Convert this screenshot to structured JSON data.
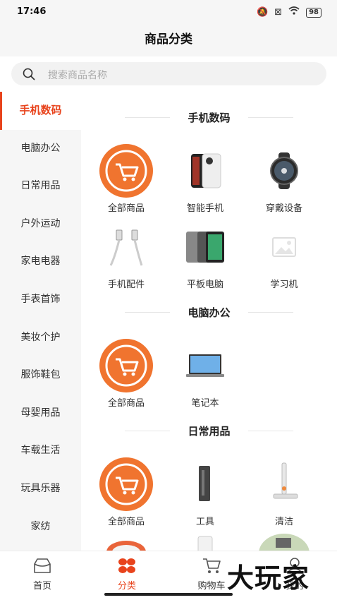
{
  "status_bar": {
    "time": "17:46",
    "icons": [
      "mute-icon",
      "sim-icon",
      "wifi-icon"
    ],
    "battery": "98"
  },
  "header": {
    "title": "商品分类"
  },
  "search": {
    "placeholder": "搜索商品名称"
  },
  "sidebar": {
    "items": [
      {
        "label": "手机数码",
        "active": true
      },
      {
        "label": "电脑办公"
      },
      {
        "label": "日常用品"
      },
      {
        "label": "户外运动"
      },
      {
        "label": "家电电器"
      },
      {
        "label": "手表首饰"
      },
      {
        "label": "美妆个护"
      },
      {
        "label": "服饰鞋包"
      },
      {
        "label": "母婴用品"
      },
      {
        "label": "车载生活"
      },
      {
        "label": "玩具乐器"
      },
      {
        "label": "家纺"
      }
    ]
  },
  "sections": [
    {
      "title": "手机数码",
      "items": [
        {
          "label": "全部商品",
          "icon": "cart-badge-icon"
        },
        {
          "label": "智能手机",
          "icon": "smartphone-icon"
        },
        {
          "label": "穿戴设备",
          "icon": "smartwatch-icon"
        },
        {
          "label": "手机配件",
          "icon": "usb-cable-icon"
        },
        {
          "label": "平板电脑",
          "icon": "tablet-icon"
        },
        {
          "label": "学习机",
          "icon": "image-placeholder-icon"
        }
      ]
    },
    {
      "title": "电脑办公",
      "items": [
        {
          "label": "全部商品",
          "icon": "cart-badge-icon"
        },
        {
          "label": "笔记本",
          "icon": "laptop-icon"
        }
      ]
    },
    {
      "title": "日常用品",
      "items": [
        {
          "label": "全部商品",
          "icon": "cart-badge-icon"
        },
        {
          "label": "工具",
          "icon": "tool-icon"
        },
        {
          "label": "清洁",
          "icon": "mop-icon"
        }
      ]
    }
  ],
  "tabbar": {
    "items": [
      {
        "label": "首页",
        "icon": "home-icon"
      },
      {
        "label": "分类",
        "icon": "category-icon",
        "active": true
      },
      {
        "label": "购物车",
        "icon": "cart-icon"
      },
      {
        "label": "我的",
        "icon": "user-icon"
      }
    ]
  },
  "watermark": "大玩家",
  "colors": {
    "accent": "#e8431c",
    "badge_orange": "#f0742f"
  }
}
